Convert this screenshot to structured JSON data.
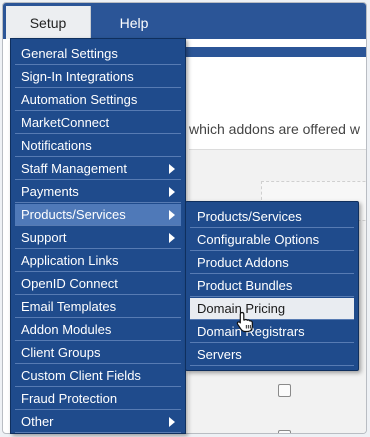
{
  "nav": {
    "tabs": [
      {
        "label": "Setup"
      },
      {
        "label": "Help"
      }
    ]
  },
  "page": {
    "intro_text": "which addons are offered w"
  },
  "menu": {
    "items": [
      {
        "label": "General Settings",
        "has_submenu": false
      },
      {
        "label": "Sign-In Integrations",
        "has_submenu": false
      },
      {
        "label": "Automation Settings",
        "has_submenu": false
      },
      {
        "label": "MarketConnect",
        "has_submenu": false
      },
      {
        "label": "Notifications",
        "has_submenu": false
      },
      {
        "label": "Staff Management",
        "has_submenu": true
      },
      {
        "label": "Payments",
        "has_submenu": true
      },
      {
        "label": "Products/Services",
        "has_submenu": true
      },
      {
        "label": "Support",
        "has_submenu": true
      },
      {
        "label": "Application Links",
        "has_submenu": false
      },
      {
        "label": "OpenID Connect",
        "has_submenu": false
      },
      {
        "label": "Email Templates",
        "has_submenu": false
      },
      {
        "label": "Addon Modules",
        "has_submenu": false
      },
      {
        "label": "Client Groups",
        "has_submenu": false
      },
      {
        "label": "Custom Client Fields",
        "has_submenu": false
      },
      {
        "label": "Fraud Protection",
        "has_submenu": false
      },
      {
        "label": "Other",
        "has_submenu": true
      }
    ],
    "selected": "Products/Services"
  },
  "submenu": {
    "items": [
      {
        "label": "Products/Services"
      },
      {
        "label": "Configurable Options"
      },
      {
        "label": "Product Addons"
      },
      {
        "label": "Product Bundles"
      },
      {
        "label": "Domain Pricing"
      },
      {
        "label": "Domain Registrars"
      },
      {
        "label": "Servers"
      }
    ],
    "hovered": "Domain Pricing"
  },
  "colors": {
    "nav_blue": "#2b5597",
    "menu_blue": "#1f4b8c",
    "menu_selected": "#4f79b8",
    "hover_bg": "#e9ecf1"
  }
}
